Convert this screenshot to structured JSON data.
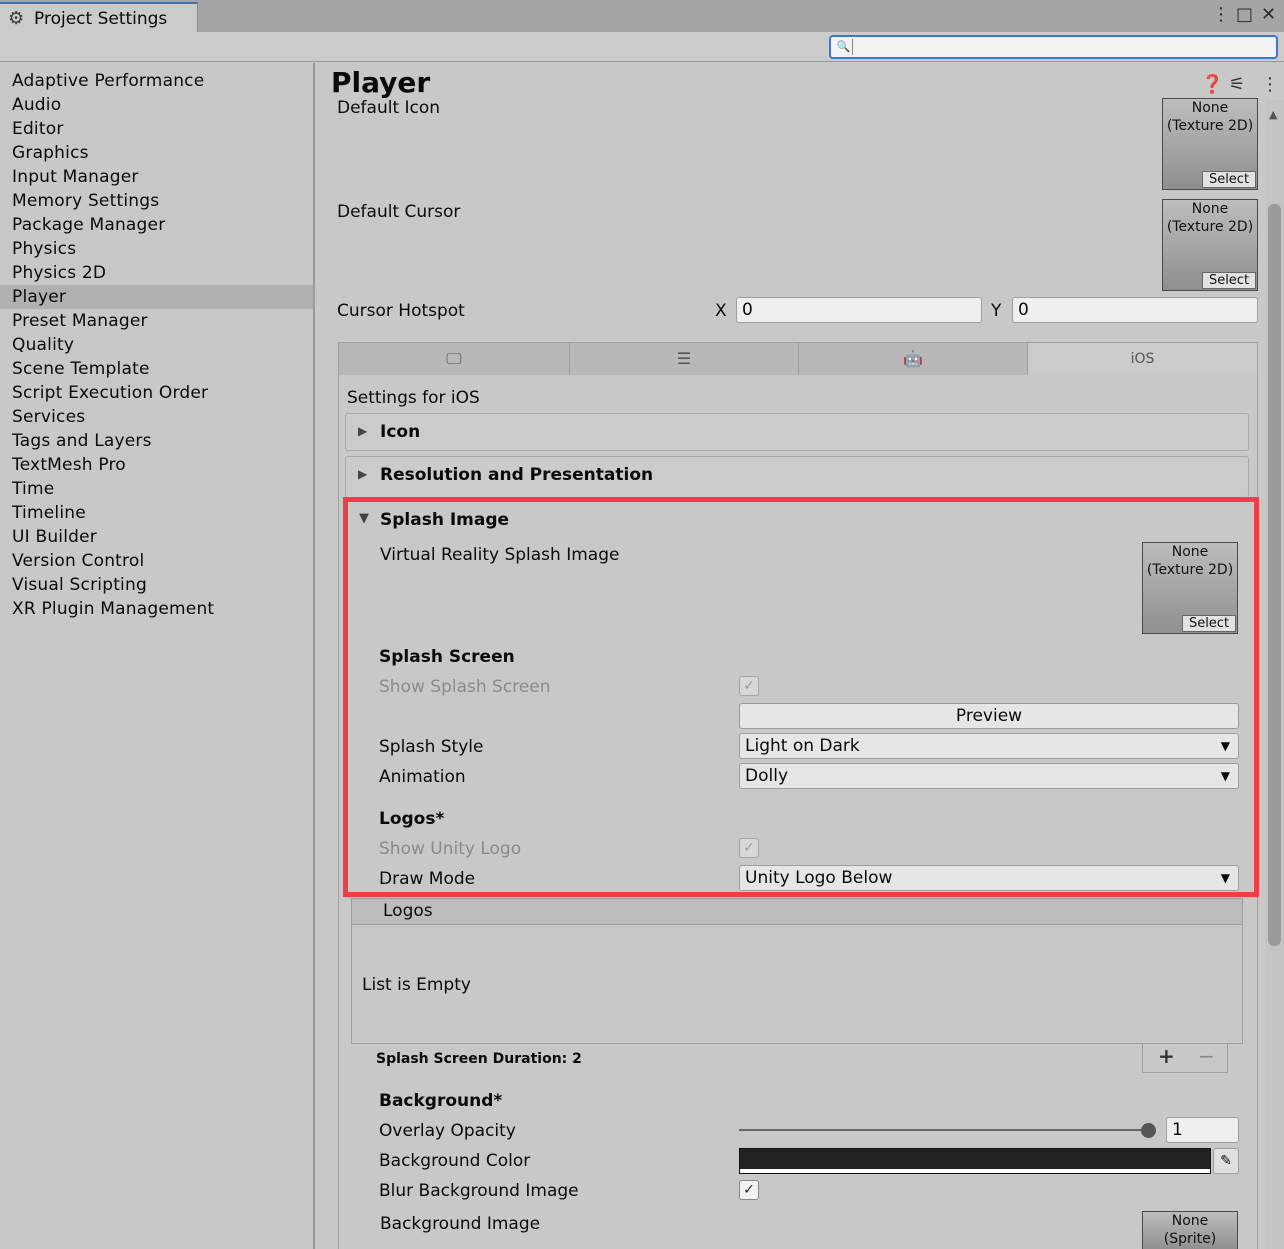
{
  "window": {
    "tab_title": "Project Settings",
    "menu_icon": "⋮",
    "maximize_icon": "□",
    "close_icon": "✕"
  },
  "search": {
    "placeholder": "",
    "icon": "search-icon"
  },
  "sidebar": {
    "items": [
      {
        "label": "Adaptive Performance"
      },
      {
        "label": "Audio"
      },
      {
        "label": "Editor"
      },
      {
        "label": "Graphics"
      },
      {
        "label": "Input Manager"
      },
      {
        "label": "Memory Settings"
      },
      {
        "label": "Package Manager"
      },
      {
        "label": "Physics"
      },
      {
        "label": "Physics 2D"
      },
      {
        "label": "Player"
      },
      {
        "label": "Preset Manager"
      },
      {
        "label": "Quality"
      },
      {
        "label": "Scene Template"
      },
      {
        "label": "Script Execution Order"
      },
      {
        "label": "Services"
      },
      {
        "label": "Tags and Layers"
      },
      {
        "label": "TextMesh Pro"
      },
      {
        "label": "Time"
      },
      {
        "label": "Timeline"
      },
      {
        "label": "UI Builder"
      },
      {
        "label": "Version Control"
      },
      {
        "label": "Visual Scripting"
      },
      {
        "label": "XR Plugin Management"
      }
    ],
    "selected": "Player"
  },
  "main": {
    "title": "Player",
    "default_icon": {
      "label": "Default Icon",
      "value_line1": "None",
      "value_line2": "(Texture 2D)",
      "select": "Select"
    },
    "default_cursor": {
      "label": "Default Cursor",
      "value_line1": "None",
      "value_line2": "(Texture 2D)",
      "select": "Select"
    },
    "cursor_hotspot": {
      "label": "Cursor Hotspot",
      "x_label": "X",
      "x_value": "0",
      "y_label": "Y",
      "y_value": "0"
    },
    "platform_tabs": [
      {
        "icon": "monitor-icon",
        "label": ""
      },
      {
        "icon": "server-icon",
        "label": ""
      },
      {
        "icon": "android-icon",
        "label": ""
      },
      {
        "icon": "",
        "label": "iOS"
      }
    ],
    "settings_for": "Settings for iOS",
    "sections": {
      "icon": "Icon",
      "resolution": "Resolution and Presentation",
      "splash": "Splash Image"
    },
    "splash": {
      "vr_splash_label": "Virtual Reality Splash Image",
      "vr_value_line1": "None",
      "vr_value_line2": "(Texture 2D)",
      "vr_select": "Select",
      "splash_screen_header": "Splash Screen",
      "show_splash_label": "Show Splash Screen",
      "show_splash_checked": true,
      "preview_button": "Preview",
      "splash_style_label": "Splash Style",
      "splash_style_value": "Light on Dark",
      "animation_label": "Animation",
      "animation_value": "Dolly",
      "logos_header": "Logos*",
      "show_unity_logo_label": "Show Unity Logo",
      "draw_mode_label": "Draw Mode",
      "draw_mode_value": "Unity Logo Below",
      "logos_list_title": "Logos",
      "list_empty": "List is Empty",
      "add": "+",
      "remove": "−",
      "duration_label": "Splash Screen Duration: 2",
      "background_header": "Background*",
      "overlay_opacity_label": "Overlay Opacity",
      "overlay_opacity_value": "1",
      "overlay_opacity_fraction": 1.0,
      "background_color_label": "Background Color",
      "background_color": "#222222",
      "blur_label": "Blur Background Image",
      "blur_checked": true,
      "background_image_label": "Background Image",
      "bg_value_line1": "None",
      "bg_value_line2": "(Sprite)"
    }
  },
  "colors": {
    "highlight": "#f03c44",
    "accent": "#3b7ad0"
  }
}
